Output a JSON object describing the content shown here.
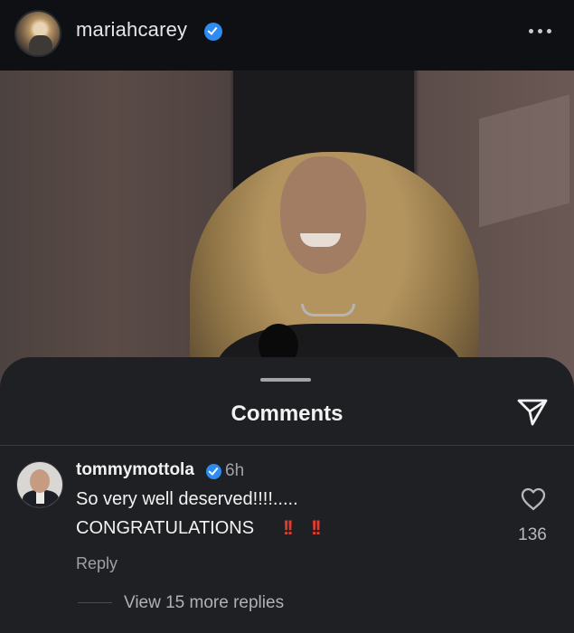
{
  "post": {
    "username": "mariahcarey",
    "verified": true,
    "more_icon": "more-horizontal-icon"
  },
  "comments_sheet": {
    "title": "Comments",
    "share_icon": "send-icon"
  },
  "comment": {
    "username": "tommymottola",
    "verified": true,
    "time": "6h",
    "text_line1": "So very well deserved!!!!.....",
    "text_line2": "CONGRATULATIONS",
    "emphasis_emoji": "‼️‼️",
    "reply_label": "Reply",
    "like_count": "136",
    "like_icon": "heart-icon",
    "view_replies_label": "View 15 more replies"
  },
  "colors": {
    "background": "#0d0e10",
    "sheet": "#1f2023",
    "verified_blue": "#2f8bf0",
    "emoji_red": "#e33b2e"
  }
}
